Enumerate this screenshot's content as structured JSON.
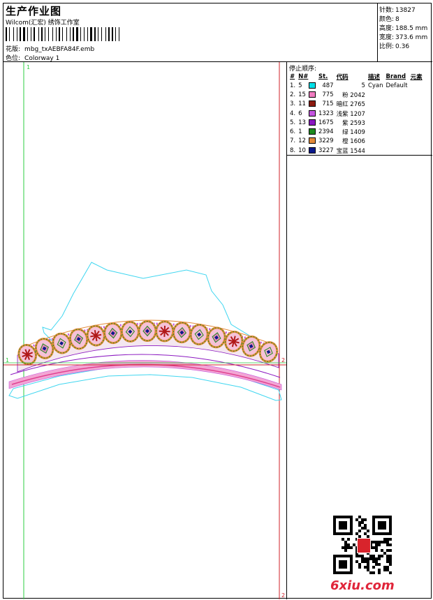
{
  "header": {
    "title": "生产作业图",
    "company": "Wilcom(汇宏) 绣饰工作室",
    "design_label": "花版:",
    "design_file": "mbg_txAEBFA84F.emb",
    "colorway_label": "色位:",
    "colorway": "Colorway 1"
  },
  "stats": {
    "stitches_label": "针数:",
    "stitches": "13827",
    "colors_label": "颜色:",
    "colors": "8",
    "height_label": "高度:",
    "height": "188.5 mm",
    "width_label": "宽度:",
    "width": "373.6 mm",
    "scale_label": "比例:",
    "scale": "0.36"
  },
  "stop_sequence": {
    "title": "停止顺序:",
    "columns": [
      "#",
      "N#",
      "St.",
      "代码",
      "描述",
      "Brand",
      "元素"
    ],
    "rows": [
      {
        "idx": "1.",
        "n": "5",
        "color": "#00e0e8",
        "st": "487",
        "code": "5",
        "desc": "Cyan",
        "brand": "Default"
      },
      {
        "idx": "2.",
        "n": "15",
        "color": "#f07bc0",
        "st": "775",
        "code": "粉 2042",
        "desc": "",
        "brand": ""
      },
      {
        "idx": "3.",
        "n": "11",
        "color": "#8c1a10",
        "st": "715",
        "code": "暗红 2765",
        "desc": "",
        "brand": ""
      },
      {
        "idx": "4.",
        "n": "6",
        "color": "#c455e0",
        "st": "1323",
        "code": "浅紫 1207",
        "desc": "",
        "brand": ""
      },
      {
        "idx": "5.",
        "n": "13",
        "color": "#8a16c0",
        "st": "1675",
        "code": "紫 2593",
        "desc": "",
        "brand": ""
      },
      {
        "idx": "6.",
        "n": "1",
        "color": "#1e8a1e",
        "st": "2394",
        "code": "绿 1409",
        "desc": "",
        "brand": ""
      },
      {
        "idx": "7.",
        "n": "12",
        "color": "#e38a3a",
        "st": "3229",
        "code": "橙 1606",
        "desc": "",
        "brand": ""
      },
      {
        "idx": "8.",
        "n": "10",
        "color": "#0a1a8c",
        "st": "3227",
        "code": "宝蓝 1544",
        "desc": "",
        "brand": ""
      }
    ]
  },
  "design_markers": {
    "left_top": "1",
    "left_mid": "1",
    "right_mid": "2",
    "right_bottom": "2"
  },
  "watermark": "6xiu.com",
  "colors": {
    "outline": "#3fd6f0",
    "green_line": "#2ecc40",
    "red_line": "#d0202a"
  }
}
